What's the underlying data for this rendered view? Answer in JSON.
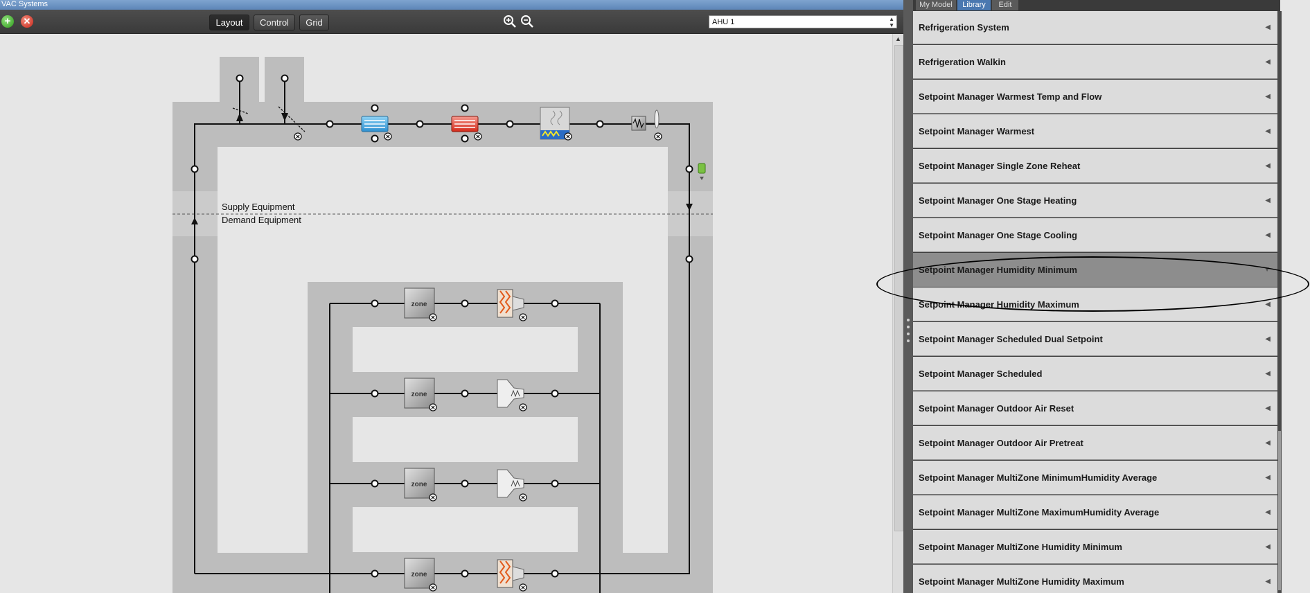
{
  "window": {
    "title": "VAC Systems"
  },
  "toolbar": {
    "add_icon": "plus-icon",
    "remove_icon": "remove-icon",
    "tabs": [
      {
        "label": "Layout",
        "active": true
      },
      {
        "label": "Control",
        "active": false
      },
      {
        "label": "Grid",
        "active": false
      }
    ],
    "zoom_in_icon": "zoom-in-icon",
    "zoom_out_icon": "zoom-out-icon",
    "system_select": {
      "value": "AHU 1"
    }
  },
  "diagram": {
    "supply_label": "Supply Equipment",
    "demand_label": "Demand Equipment",
    "zones": [
      {
        "label": "zone",
        "terminal": "reheat-terminal"
      },
      {
        "label": "zone",
        "terminal": "vav-terminal"
      },
      {
        "label": "zone",
        "terminal": "vav-terminal"
      },
      {
        "label": "zone",
        "terminal": "reheat-terminal"
      }
    ],
    "supply_components": [
      "oa-relief-damper",
      "oa-intake-damper",
      "cooling-coil",
      "heating-coil",
      "humidifier",
      "supply-fan",
      "setpoint-manager"
    ]
  },
  "library": {
    "tabs": [
      {
        "label": "My Model",
        "active": false
      },
      {
        "label": "Library",
        "active": true
      },
      {
        "label": "Edit",
        "active": false
      }
    ],
    "items": [
      {
        "label": "Refrigeration System",
        "selected": false
      },
      {
        "label": "Refrigeration Walkin",
        "selected": false
      },
      {
        "label": "Setpoint Manager Warmest Temp and Flow",
        "selected": false
      },
      {
        "label": "Setpoint Manager Warmest",
        "selected": false
      },
      {
        "label": "Setpoint Manager Single Zone Reheat",
        "selected": false
      },
      {
        "label": "Setpoint Manager One Stage Heating",
        "selected": false
      },
      {
        "label": "Setpoint Manager One Stage Cooling",
        "selected": false
      },
      {
        "label": "Setpoint Manager Humidity Minimum",
        "selected": true
      },
      {
        "label": "Setpoint Manager Humidity Maximum",
        "selected": false
      },
      {
        "label": "Setpoint Manager Scheduled Dual Setpoint",
        "selected": false
      },
      {
        "label": "Setpoint Manager Scheduled",
        "selected": false
      },
      {
        "label": "Setpoint Manager Outdoor Air Reset",
        "selected": false
      },
      {
        "label": "Setpoint Manager Outdoor Air Pretreat",
        "selected": false
      },
      {
        "label": "Setpoint Manager MultiZone MinimumHumidity Average",
        "selected": false
      },
      {
        "label": "Setpoint Manager MultiZone MaximumHumidity Average",
        "selected": false
      },
      {
        "label": "Setpoint Manager MultiZone Humidity Minimum",
        "selected": false
      },
      {
        "label": "Setpoint Manager MultiZone Humidity Maximum",
        "selected": false
      }
    ],
    "collapsed_arrow": "◀",
    "expanded_arrow": "▼"
  },
  "colors": {
    "loop_band": "#bdbdbd",
    "canvas_bg": "#e6e6e6",
    "toolbar_bg": "#444444",
    "selected_item": "#8d8d8d"
  }
}
